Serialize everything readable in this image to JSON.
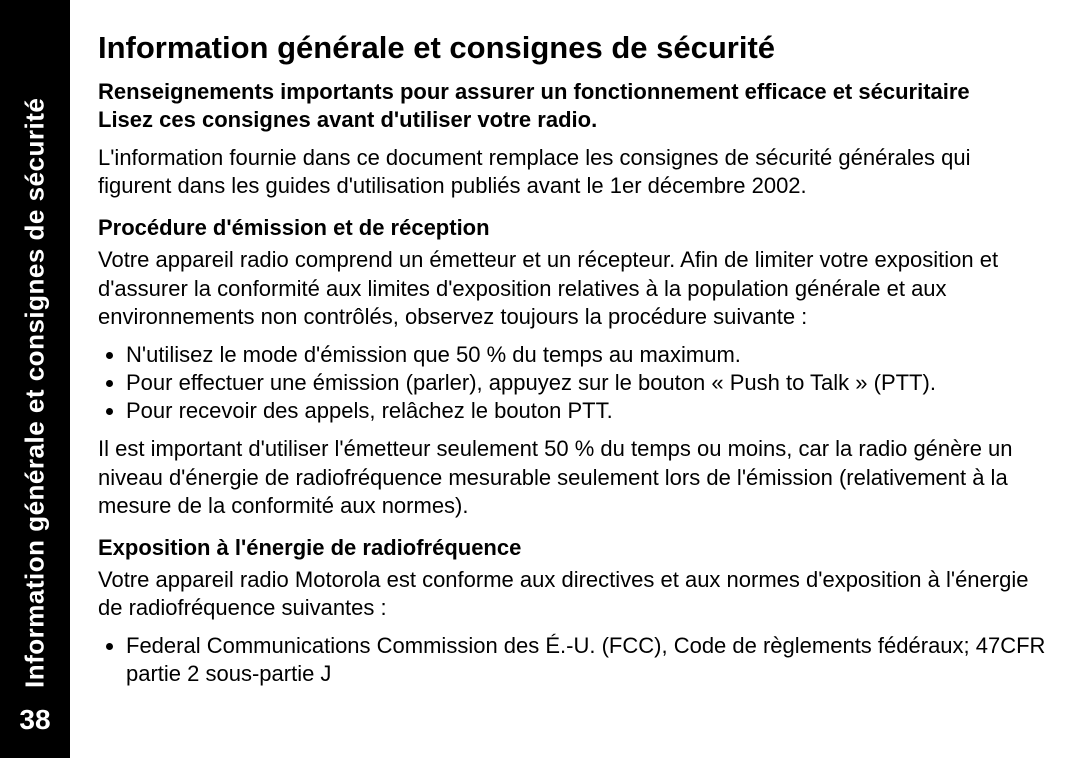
{
  "side": {
    "label": "Information générale et consignes de sécurité",
    "pageNumber": "38"
  },
  "title": "Information générale et consignes de sécurité",
  "intro_bold_1": "Renseignements importants pour assurer un fonctionnement efficace et sécuritaire",
  "intro_bold_2": "Lisez ces consignes avant d'utiliser votre radio.",
  "intro_para": "L'information fournie dans ce document remplace les consignes de sécurité générales qui figurent dans les guides d'utilisation publiés avant le 1er décembre 2002.",
  "section1_heading": "Procédure d'émission et de réception",
  "section1_para": "Votre appareil radio comprend un émetteur et un récepteur. Afin de limiter votre exposition et d'assurer la conformité aux limites d'exposition relatives à la population générale et aux environnements non contrôlés, observez toujours la procédure suivante :",
  "section1_bullets": [
    "N'utilisez le mode d'émission que 50 % du temps au maximum.",
    "Pour effectuer une émission (parler), appuyez sur le bouton « Push to Talk » (PTT).",
    "Pour recevoir des appels, relâchez le bouton PTT."
  ],
  "section1_para2": "Il est important d'utiliser l'émetteur seulement 50 % du temps ou moins, car la radio génère un niveau d'énergie de radiofréquence mesurable seulement lors de l'émission (relativement à la mesure de la conformité aux normes).",
  "section2_heading": "Exposition à l'énergie de radiofréquence",
  "section2_para": "Votre appareil radio Motorola est conforme aux directives et aux normes d'exposition à l'énergie de radiofréquence suivantes :",
  "section2_bullets": [
    "Federal Communications Commission des É.-U. (FCC), Code de règlements fédéraux; 47CFR partie 2 sous-partie J"
  ]
}
